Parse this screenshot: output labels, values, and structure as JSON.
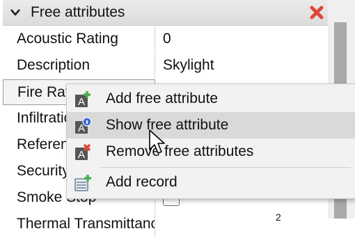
{
  "panel": {
    "title": "Free attributes",
    "rows": [
      {
        "name": "Acoustic Rating",
        "value": "0"
      },
      {
        "name": "Description",
        "value": "Skylight"
      },
      {
        "name": "Fire Rating",
        "value": ""
      },
      {
        "name": "Infiltration",
        "value": ""
      },
      {
        "name": "Reference",
        "value": ""
      },
      {
        "name": "Security Rating",
        "value": ""
      },
      {
        "name": "Smoke Stop",
        "value": ""
      },
      {
        "name": "Thermal Transmittance",
        "value": "2"
      }
    ]
  },
  "context_menu": {
    "items": [
      {
        "label": "Add free attribute",
        "icon": "add-free-attribute-icon"
      },
      {
        "label": "Show free attribute",
        "icon": "show-free-attribute-icon"
      },
      {
        "label": "Remove free attributes",
        "icon": "remove-free-attributes-icon"
      },
      {
        "label": "Add record",
        "icon": "add-record-icon"
      }
    ],
    "hovered_index": 1
  },
  "colors": {
    "close_red": "#e0453a",
    "add_green": "#4caf50",
    "info_blue": "#3b6fd6",
    "hover_bg": "#d9d9d9"
  }
}
